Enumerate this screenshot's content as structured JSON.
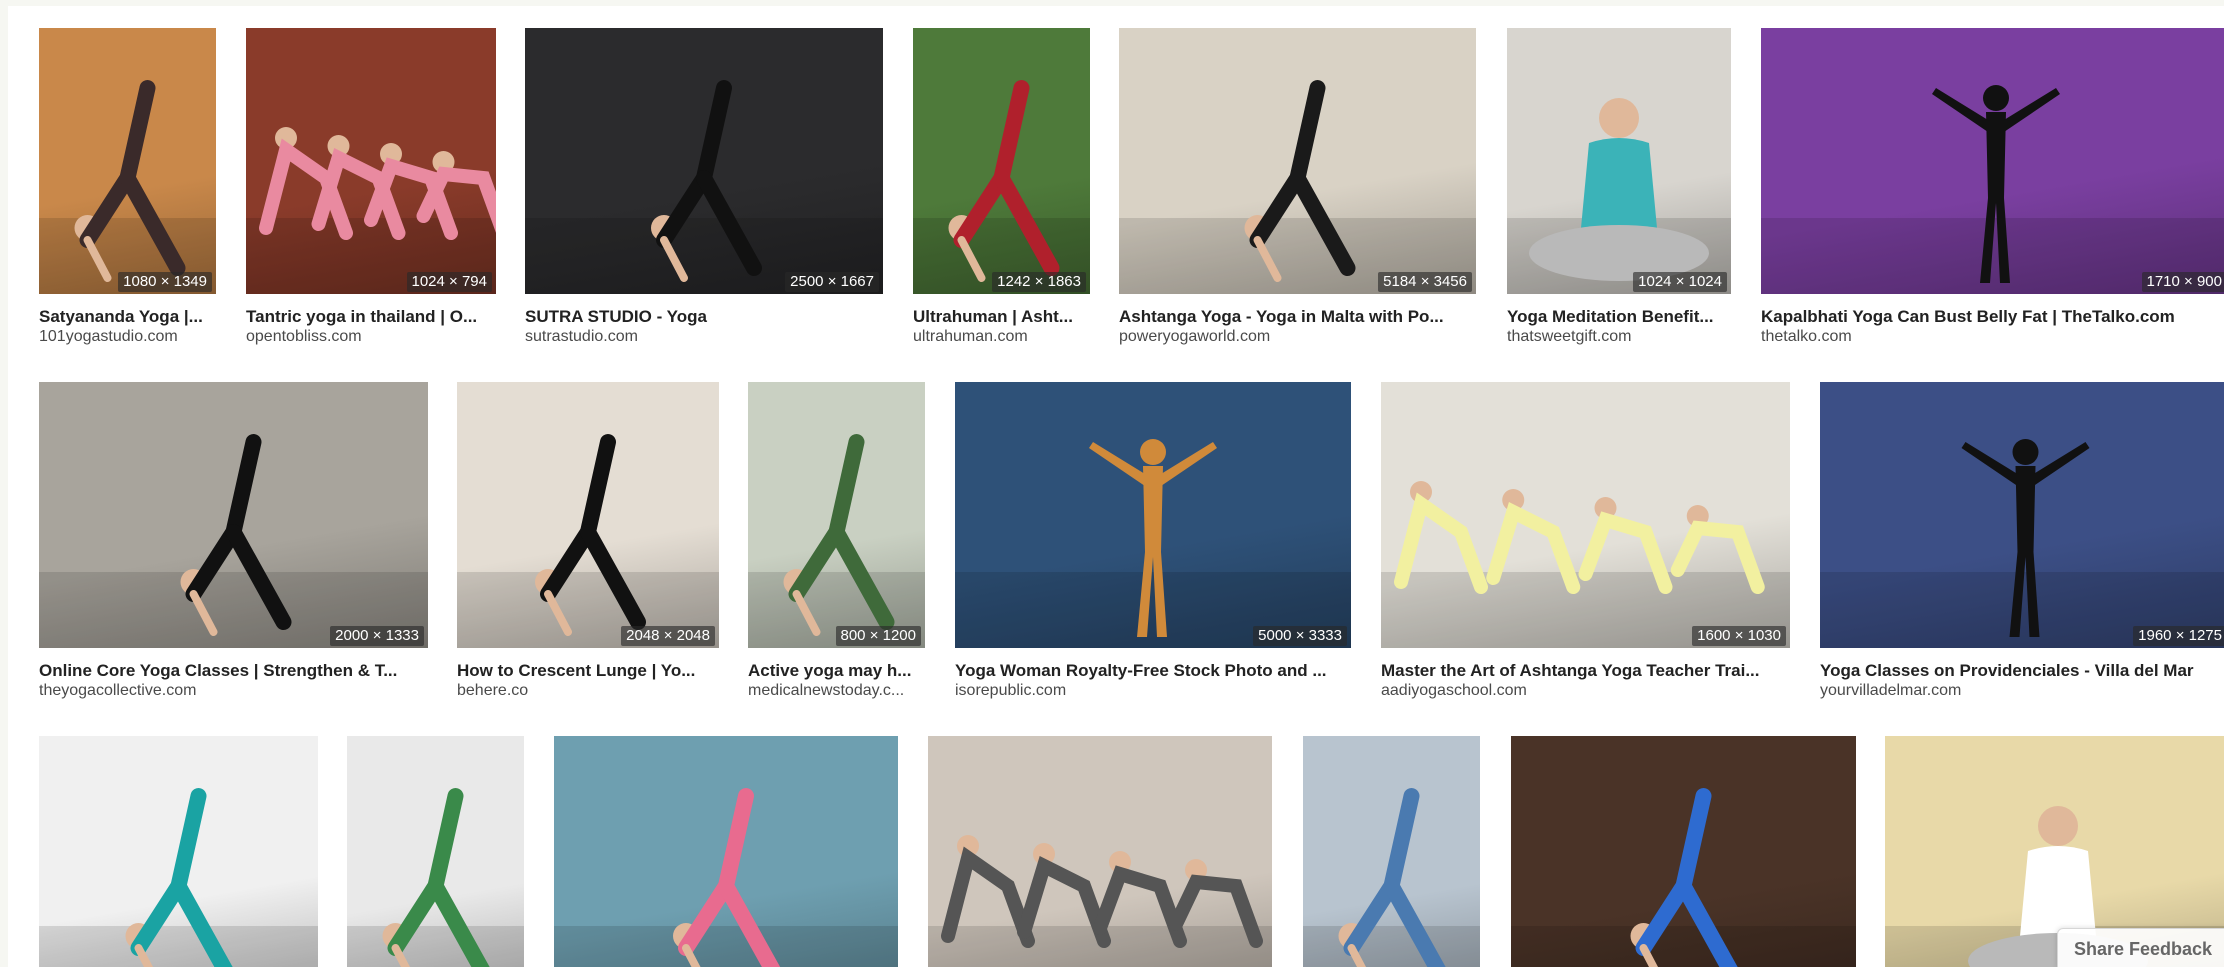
{
  "results": [
    {
      "title": "Satyananda Yoga |...",
      "source": "101yogastudio.com",
      "dims": "1080 × 1349",
      "bg": "#c9884a",
      "fg": "#3a2a2a",
      "subject": "yoga-pose-on-rock"
    },
    {
      "title": "Tantric yoga in thailand | O...",
      "source": "opentobliss.com",
      "dims": "1024 × 794",
      "bg": "#8a3b2a",
      "fg": "#e98aa0",
      "subject": "group-yoga-class"
    },
    {
      "title": "SUTRA STUDIO - Yoga",
      "source": "sutrastudio.com",
      "dims": "2500 × 1667",
      "bg": "#2b2b2d",
      "fg": "#111111",
      "subject": "downward-dog-studio"
    },
    {
      "title": "Ultrahuman | Asht...",
      "source": "ultrahuman.com",
      "dims": "1242 × 1863",
      "bg": "#4e7a3a",
      "fg": "#b0202c",
      "subject": "standing-pose-by-lake"
    },
    {
      "title": "Ashtanga Yoga - Yoga in Malta with Po...",
      "source": "poweryogaworld.com",
      "dims": "5184 × 3456",
      "bg": "#d9d2c5",
      "fg": "#1a1a1a",
      "subject": "standing-leg-raise"
    },
    {
      "title": "Yoga Meditation Benefit...",
      "source": "thatsweetgift.com",
      "dims": "1024 × 1024",
      "bg": "#d8d5cf",
      "fg": "#3bb3b8",
      "subject": "meditation-hands"
    },
    {
      "title": "Kapalbhati Yoga Can Bust Belly Fat | TheTalko.com",
      "source": "thetalko.com",
      "dims": "1710 × 900",
      "bg": "#7a3fa0",
      "fg": "#111111",
      "subject": "tree-pose-silhouette"
    },
    {
      "title": "Online Core Yoga Classes | Strengthen & T...",
      "source": "theyogacollective.com",
      "dims": "2000 × 1333",
      "bg": "#a8a49c",
      "fg": "#111111",
      "subject": "core-yoga-pose"
    },
    {
      "title": "How to Crescent Lunge | Yo...",
      "source": "behere.co",
      "dims": "2048 × 2048",
      "bg": "#e4ddd3",
      "fg": "#111111",
      "subject": "crescent-lunge"
    },
    {
      "title": "Active yoga may h...",
      "source": "medicalnewstoday.c...",
      "dims": "800 × 1200",
      "bg": "#c9d0c2",
      "fg": "#3f6a3a",
      "subject": "yoga-on-mat-indoor"
    },
    {
      "title": "Yoga Woman Royalty-Free Stock Photo and ...",
      "source": "isorepublic.com",
      "dims": "5000 × 3333",
      "bg": "#2e5178",
      "fg": "#d08a3a",
      "subject": "handstand-at-sunset"
    },
    {
      "title": "Master the Art of Ashtanga Yoga Teacher Trai...",
      "source": "aadiyogaschool.com",
      "dims": "1600 × 1030",
      "bg": "#e3e0d8",
      "fg": "#f2f0a0",
      "subject": "group-downward-dog"
    },
    {
      "title": "Yoga Classes on Providenciales - Villa del Mar",
      "source": "yourvilladelmar.com",
      "dims": "1960 × 1275",
      "bg": "#3c4f86",
      "fg": "#111111",
      "subject": "dancer-pose-silhouette"
    },
    {
      "title": "",
      "source": "",
      "dims": "",
      "bg": "#f0f0f0",
      "fg": "#1aa3a3",
      "subject": "backbend-with-wheel"
    },
    {
      "title": "",
      "source": "",
      "dims": "",
      "bg": "#e9e9e9",
      "fg": "#3a8a4a",
      "subject": "forward-bend"
    },
    {
      "title": "",
      "source": "",
      "dims": "",
      "bg": "#6e9fb0",
      "fg": "#e86b8f",
      "subject": "beach-yoga"
    },
    {
      "title": "",
      "source": "",
      "dims": "",
      "bg": "#cfc6bc",
      "fg": "#555555",
      "subject": "seated-meditation-group"
    },
    {
      "title": "",
      "source": "",
      "dims": "",
      "bg": "#b8c4cf",
      "fg": "#4a7ab0",
      "subject": "warrior-pose-rooftop"
    },
    {
      "title": "",
      "source": "",
      "dims": "",
      "bg": "#4a3327",
      "fg": "#2e6bd0",
      "subject": "reclining-twist"
    },
    {
      "title": "",
      "source": "",
      "dims": "",
      "bg": "#e8d9a8",
      "fg": "#ffffff",
      "subject": "meditation-at-beach"
    }
  ],
  "share_feedback": "Share Feedback"
}
